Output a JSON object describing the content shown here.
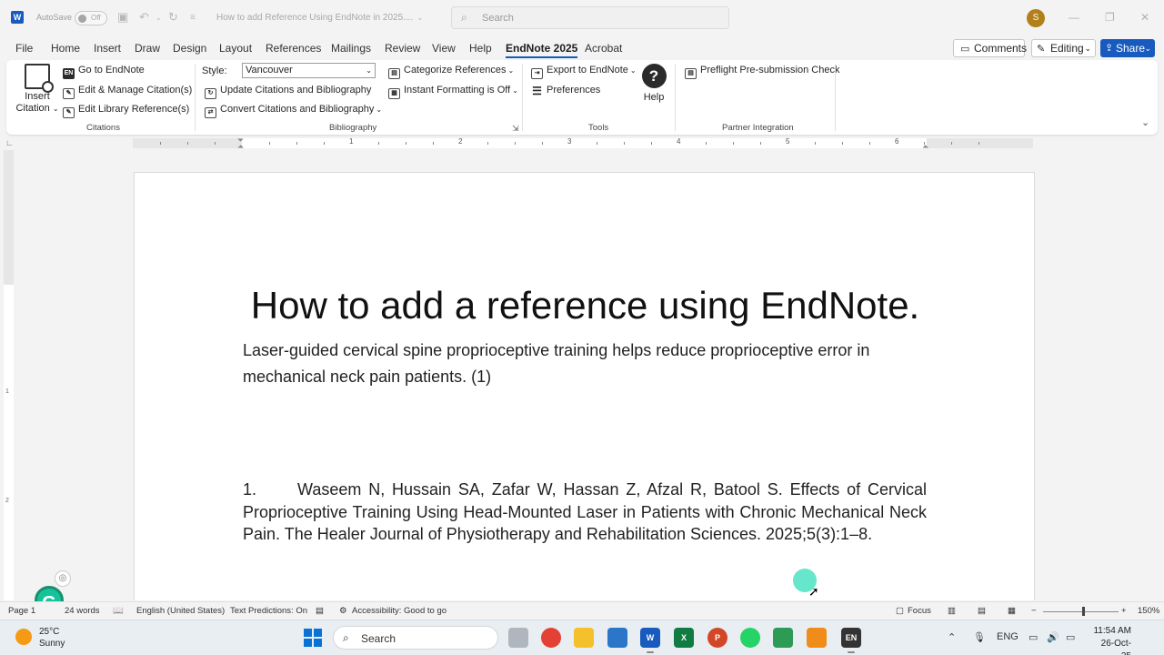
{
  "titlebar": {
    "autosave_label": "AutoSave",
    "autosave_state": "Off",
    "doc_title": "How to add Reference Using EndNote in 2025....",
    "search_placeholder": "Search",
    "avatar_initial": "S"
  },
  "menu": {
    "items": [
      "File",
      "Home",
      "Insert",
      "Draw",
      "Design",
      "Layout",
      "References",
      "Mailings",
      "Review",
      "View",
      "Help",
      "EndNote 2025",
      "Acrobat"
    ],
    "active": "EndNote 2025",
    "comments": "Comments",
    "editing": "Editing",
    "share": "Share"
  },
  "ribbon": {
    "insert_citation_1": "Insert",
    "insert_citation_2": "Citation",
    "go_to_endnote": "Go to EndNote",
    "edit_manage": "Edit & Manage Citation(s)",
    "edit_library": "Edit Library Reference(s)",
    "citations_group": "Citations",
    "style_label": "Style:",
    "style_value": "Vancouver",
    "update_citations": "Update Citations and Bibliography",
    "convert_citations": "Convert Citations and Bibliography",
    "categorize_refs": "Categorize References",
    "instant_formatting": "Instant Formatting is Off",
    "bibliography_group": "Bibliography",
    "export_endnote": "Export to EndNote",
    "preferences": "Preferences",
    "help": "Help",
    "tools_group": "Tools",
    "preflight": "Preflight Pre-submission Check",
    "partner_group": "Partner Integration"
  },
  "ruler": {
    "numbers": [
      "1",
      "2",
      "3",
      "4",
      "5",
      "6"
    ]
  },
  "vruler": {
    "numbers": [
      "1",
      "2"
    ]
  },
  "document": {
    "heading": "How to add a reference using EndNote.",
    "body": "Laser-guided cervical spine proprioceptive training helps reduce proprioceptive error in mechanical neck pain patients.  (1)",
    "ref_number": "1.",
    "ref_text": "Waseem N, Hussain SA, Zafar W, Hassan Z, Afzal R, Batool S. Effects of Cervical Proprioceptive Training Using Head-Mounted Laser in Patients with Chronic Mechanical Neck Pain. The Healer Journal of Physiotherapy and Rehabilitation Sciences. 2025;5(3):1–8."
  },
  "statusbar": {
    "page": "Page 1",
    "words": "24 words",
    "language": "English (United States)",
    "predictions": "Text Predictions: On",
    "accessibility": "Accessibility: Good to go",
    "focus": "Focus",
    "zoom": "150%"
  },
  "taskbar": {
    "temperature": "25°C",
    "weather": "Sunny",
    "search_placeholder": "Search",
    "language": "ENG",
    "time": "11:54 AM",
    "date": "26-Oct-25"
  },
  "colors": {
    "accent": "#185abd",
    "grammarly": "#15c39a"
  }
}
